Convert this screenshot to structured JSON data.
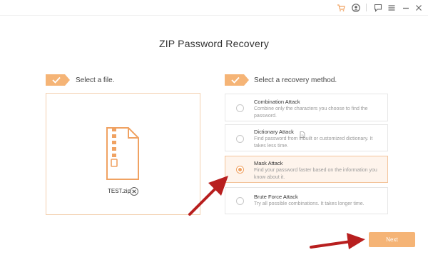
{
  "app": {
    "title": "ZIP Password Recovery"
  },
  "titlebar": {
    "icons": [
      "cart-icon",
      "account-icon",
      "feedback-icon",
      "menu-icon",
      "minimize-icon"
    ]
  },
  "steps": {
    "file": {
      "label": "Select a file."
    },
    "method": {
      "label": "Select a recovery method."
    }
  },
  "file_panel": {
    "file_name": "TEST.zip"
  },
  "methods": [
    {
      "title": "Combination Attack",
      "description": "Combine only the characters you choose to find the password.",
      "selected": false
    },
    {
      "title": "Dictionary Attack",
      "description": "Find password from inbuilt or customized dictionary. It takes less time.",
      "selected": false
    },
    {
      "title": "Mask Attack",
      "description": "Find your password faster based on the information you know about it.",
      "selected": true
    },
    {
      "title": "Brute Force Attack",
      "description": "Try all possible combinations. It takes longer time.",
      "selected": false
    }
  ],
  "footer": {
    "next_label": "Next"
  },
  "colors": {
    "accent": "#f5b476",
    "accent_dark": "#f0a262",
    "selected_bg": "#fef4ec",
    "annotation_arrow": "#b81f1f"
  }
}
